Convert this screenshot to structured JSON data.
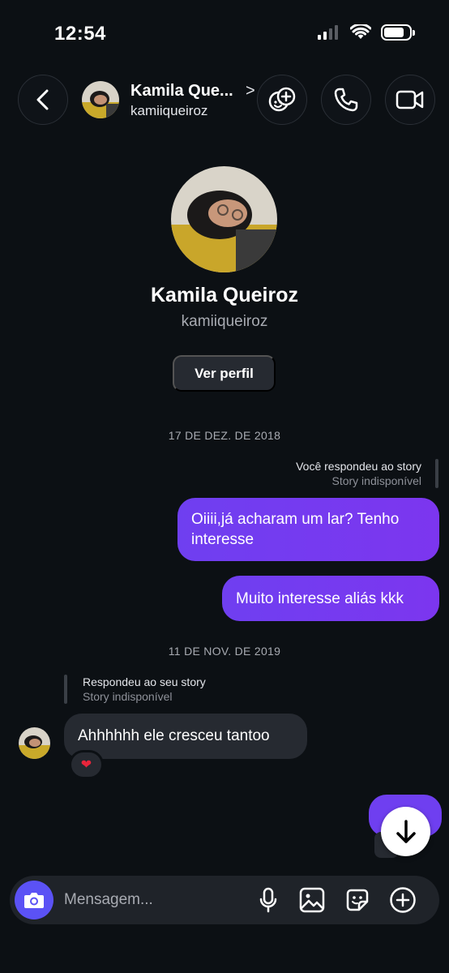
{
  "status": {
    "time": "12:54"
  },
  "header": {
    "name": "Kamila Que...",
    "username": "kamiiqueiroz",
    "chevron": ">"
  },
  "profile": {
    "name": "Kamila Queiroz",
    "username": "kamiiqueiroz",
    "view_profile_label": "Ver perfil"
  },
  "conversation": {
    "date1": "17 DE DEZ. DE 2018",
    "outgoing_reply": {
      "title": "Você respondeu ao story",
      "subtitle": "Story indisponível"
    },
    "outgoing_messages": [
      "Oiiii,já acharam um lar? Tenho interesse",
      "Muito interesse aliás kkk"
    ],
    "date2": "11 DE NOV. DE 2019",
    "incoming_reply": {
      "title": "Respondeu ao seu story",
      "subtitle": "Story indisponível"
    },
    "incoming_message": "Ahhhhhh ele cresceu tantoo",
    "reaction": "❤"
  },
  "composer": {
    "placeholder": "Mensagem..."
  },
  "colors": {
    "background": "#0c1014",
    "outgoing_bubble": "#6f3ff0",
    "incoming_bubble": "#262a31",
    "camera_button": "#5b52f5"
  },
  "icons": [
    "back-icon",
    "effects-icon",
    "phone-icon",
    "video-icon",
    "arrow-down-icon",
    "camera-icon",
    "microphone-icon",
    "gallery-icon",
    "sticker-icon",
    "plus-icon",
    "heart-icon"
  ]
}
